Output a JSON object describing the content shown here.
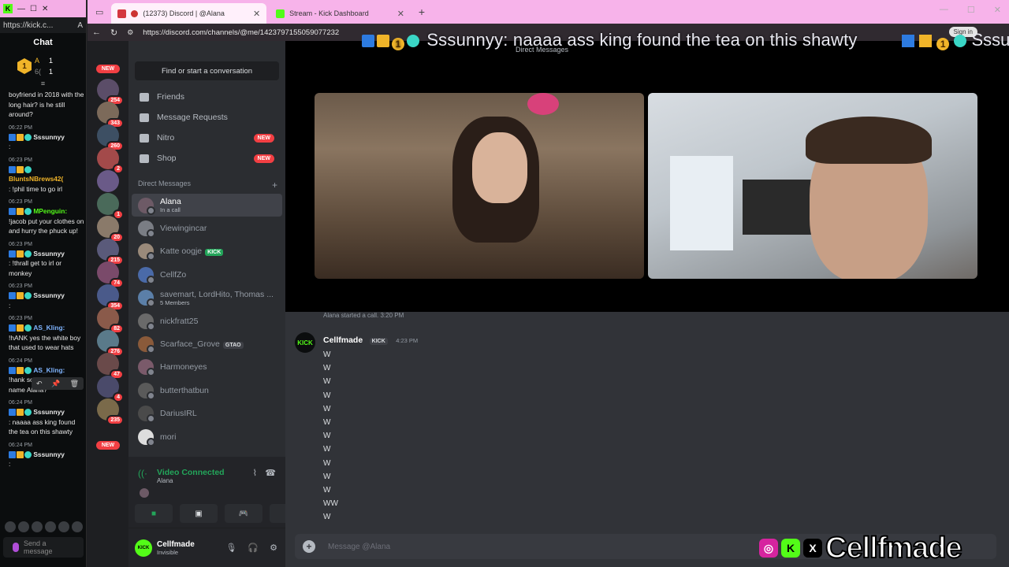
{
  "chat_window": {
    "url": "https://kick.c...",
    "title": "Chat",
    "pinned_lines": [
      "A",
      "6("
    ],
    "pinned_counts": [
      "1",
      "1"
    ],
    "messages": [
      {
        "time": "",
        "user": "",
        "text": "boyfriend in 2018 with the long hair? is he still around?"
      },
      {
        "time": "06:22 PM",
        "user": "Sssunnyy",
        "text": ":"
      },
      {
        "time": "06:23 PM",
        "user": "BluntsNBrews42(",
        "text": ": !phil time to go irl"
      },
      {
        "time": "06:23 PM",
        "user": "MPenguin:",
        "text": "!jacob put your clothes on and hurry the phuck up!"
      },
      {
        "time": "06:23 PM",
        "user": "Sssunnyy",
        "text": ": !thrall get to irl or monkey"
      },
      {
        "time": "06:23 PM",
        "user": "Sssunnyy",
        "text": ":"
      },
      {
        "time": "06:23 PM",
        "user": "AS_Kling:",
        "text": "!hANK yes the white boy that used to wear hats"
      },
      {
        "time": "06:24 PM",
        "user": "AS_Kling:",
        "text": "!hank so what was his name Alana?"
      },
      {
        "time": "06:24 PM",
        "user": "Sssunnyy",
        "text": ": naaaa ass king found the tea on this shawty"
      },
      {
        "time": "06:24 PM",
        "user": "Sssunnyy",
        "text": ":"
      }
    ],
    "send_placeholder": "Send a message"
  },
  "browser": {
    "tabs": [
      {
        "label": "(12373) Discord | @Alana",
        "active": true
      },
      {
        "label": "Stream - Kick Dashboard",
        "active": false
      }
    ],
    "url": "https://discord.com/channels/@me/1423797155059077232",
    "sign_in": "Sign in"
  },
  "ticker": {
    "text": "Sssunnyy: naaaa ass king found the tea on this shawty",
    "badge_number": "1",
    "repeat_text": "Sssunnyy:"
  },
  "discord": {
    "servers": [
      {
        "badge": "NEW"
      },
      {
        "count": "254"
      },
      {
        "count": "343"
      },
      {
        "count": "260"
      },
      {
        "count": "2"
      },
      {
        "count": ""
      },
      {
        "count": "1"
      },
      {
        "count": "20"
      },
      {
        "count": "215"
      },
      {
        "count": "74"
      },
      {
        "count": "354"
      },
      {
        "count": "82"
      },
      {
        "count": "276"
      },
      {
        "count": "47"
      },
      {
        "count": "4"
      },
      {
        "count": "235"
      },
      {
        "badge": "NEW"
      }
    ],
    "find_placeholder": "Find or start a conversation",
    "nav": [
      {
        "label": "Friends",
        "badge": ""
      },
      {
        "label": "Message Requests",
        "badge": ""
      },
      {
        "label": "Nitro",
        "badge": "NEW"
      },
      {
        "label": "Shop",
        "badge": "NEW"
      }
    ],
    "dm_header": "Direct Messages",
    "dms": [
      {
        "name": "Alana",
        "sub": "In a call",
        "tag": "",
        "active": true
      },
      {
        "name": "Viewingincar",
        "sub": "",
        "tag": ""
      },
      {
        "name": "Katte oogje",
        "sub": "",
        "tag": "KICK"
      },
      {
        "name": "CellfZo",
        "sub": "",
        "tag": ""
      },
      {
        "name": "savemart, LordHito, Thomas ...",
        "sub": "5 Members",
        "tag": ""
      },
      {
        "name": "nickfratt25",
        "sub": "",
        "tag": ""
      },
      {
        "name": "Scarface_Grove",
        "sub": "",
        "tag": "GTAO"
      },
      {
        "name": "Harmoneyes",
        "sub": "",
        "tag": ""
      },
      {
        "name": "butterthatbun",
        "sub": "",
        "tag": ""
      },
      {
        "name": "DariusIRL",
        "sub": "",
        "tag": ""
      },
      {
        "name": "mori",
        "sub": "",
        "tag": ""
      }
    ],
    "voice": {
      "status": "Video Connected",
      "channel": "Alana"
    },
    "user": {
      "name": "Cellfmade",
      "status": "Invisible",
      "avatar_text": "KICK"
    },
    "call_header": "Direct Messages",
    "system_line": "Alana started a call. 3:20 PM",
    "message": {
      "author": "Cellfmade",
      "tag": "KICK",
      "time": "4:23 PM",
      "lines": [
        "W",
        "W",
        "W",
        "W",
        "W",
        "W",
        "W",
        "W",
        "W",
        "W",
        "W",
        "WW",
        "W"
      ]
    },
    "composer_placeholder": "Message @Alana"
  },
  "watermark": {
    "name": "Cellfmade"
  },
  "colors": {
    "kick_green": "#53fc18",
    "discord_red": "#f23f43",
    "tab_pink": "#f7b3ea"
  }
}
